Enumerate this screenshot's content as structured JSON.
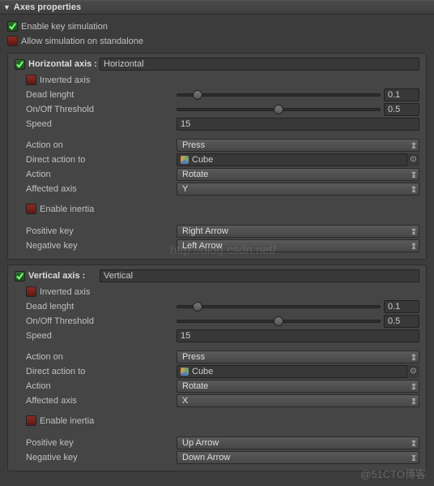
{
  "panel": {
    "title": "Axes properties"
  },
  "top": {
    "enable_key_sim": {
      "label": "Enable key simulation",
      "checked": true
    },
    "allow_standalone": {
      "label": "Allow simulation on standalone",
      "checked": false
    }
  },
  "axes": [
    {
      "title": "Horizontal axis :",
      "name_value": "Horizontal",
      "inverted": {
        "label": "Inverted axis",
        "checked": false
      },
      "dead_length": {
        "label": "Dead lenght",
        "value": "0.1",
        "pos": 10
      },
      "threshold": {
        "label": "On/Off Threshold",
        "value": "0.5",
        "pos": 50
      },
      "speed": {
        "label": "Speed",
        "value": "15"
      },
      "action_on": {
        "label": "Action on",
        "value": "Press"
      },
      "direct_to": {
        "label": "Direct action to",
        "value": "Cube"
      },
      "action": {
        "label": "Action",
        "value": "Rotate"
      },
      "affected": {
        "label": "Affected axis",
        "value": "Y"
      },
      "inertia": {
        "label": "Enable inertia",
        "checked": false
      },
      "pos_key": {
        "label": "Positive key",
        "value": "Right Arrow"
      },
      "neg_key": {
        "label": "Negative key",
        "value": "Left Arrow"
      }
    },
    {
      "title": "Vertical axis :",
      "name_value": "Vertical",
      "inverted": {
        "label": "Inverted axis",
        "checked": false
      },
      "dead_length": {
        "label": "Dead lenght",
        "value": "0.1",
        "pos": 10
      },
      "threshold": {
        "label": "On/Off Threshold",
        "value": "0.5",
        "pos": 50
      },
      "speed": {
        "label": "Speed",
        "value": "15"
      },
      "action_on": {
        "label": "Action on",
        "value": "Press"
      },
      "direct_to": {
        "label": "Direct action to",
        "value": "Cube"
      },
      "action": {
        "label": "Action",
        "value": "Rotate"
      },
      "affected": {
        "label": "Affected axis",
        "value": "X"
      },
      "inertia": {
        "label": "Enable inertia",
        "checked": false
      },
      "pos_key": {
        "label": "Positive key",
        "value": "Up Arrow"
      },
      "neg_key": {
        "label": "Negative key",
        "value": "Down Arrow"
      }
    }
  ],
  "watermark": "http://blog.csdn.net/",
  "watermark2": "@51CTO博客"
}
